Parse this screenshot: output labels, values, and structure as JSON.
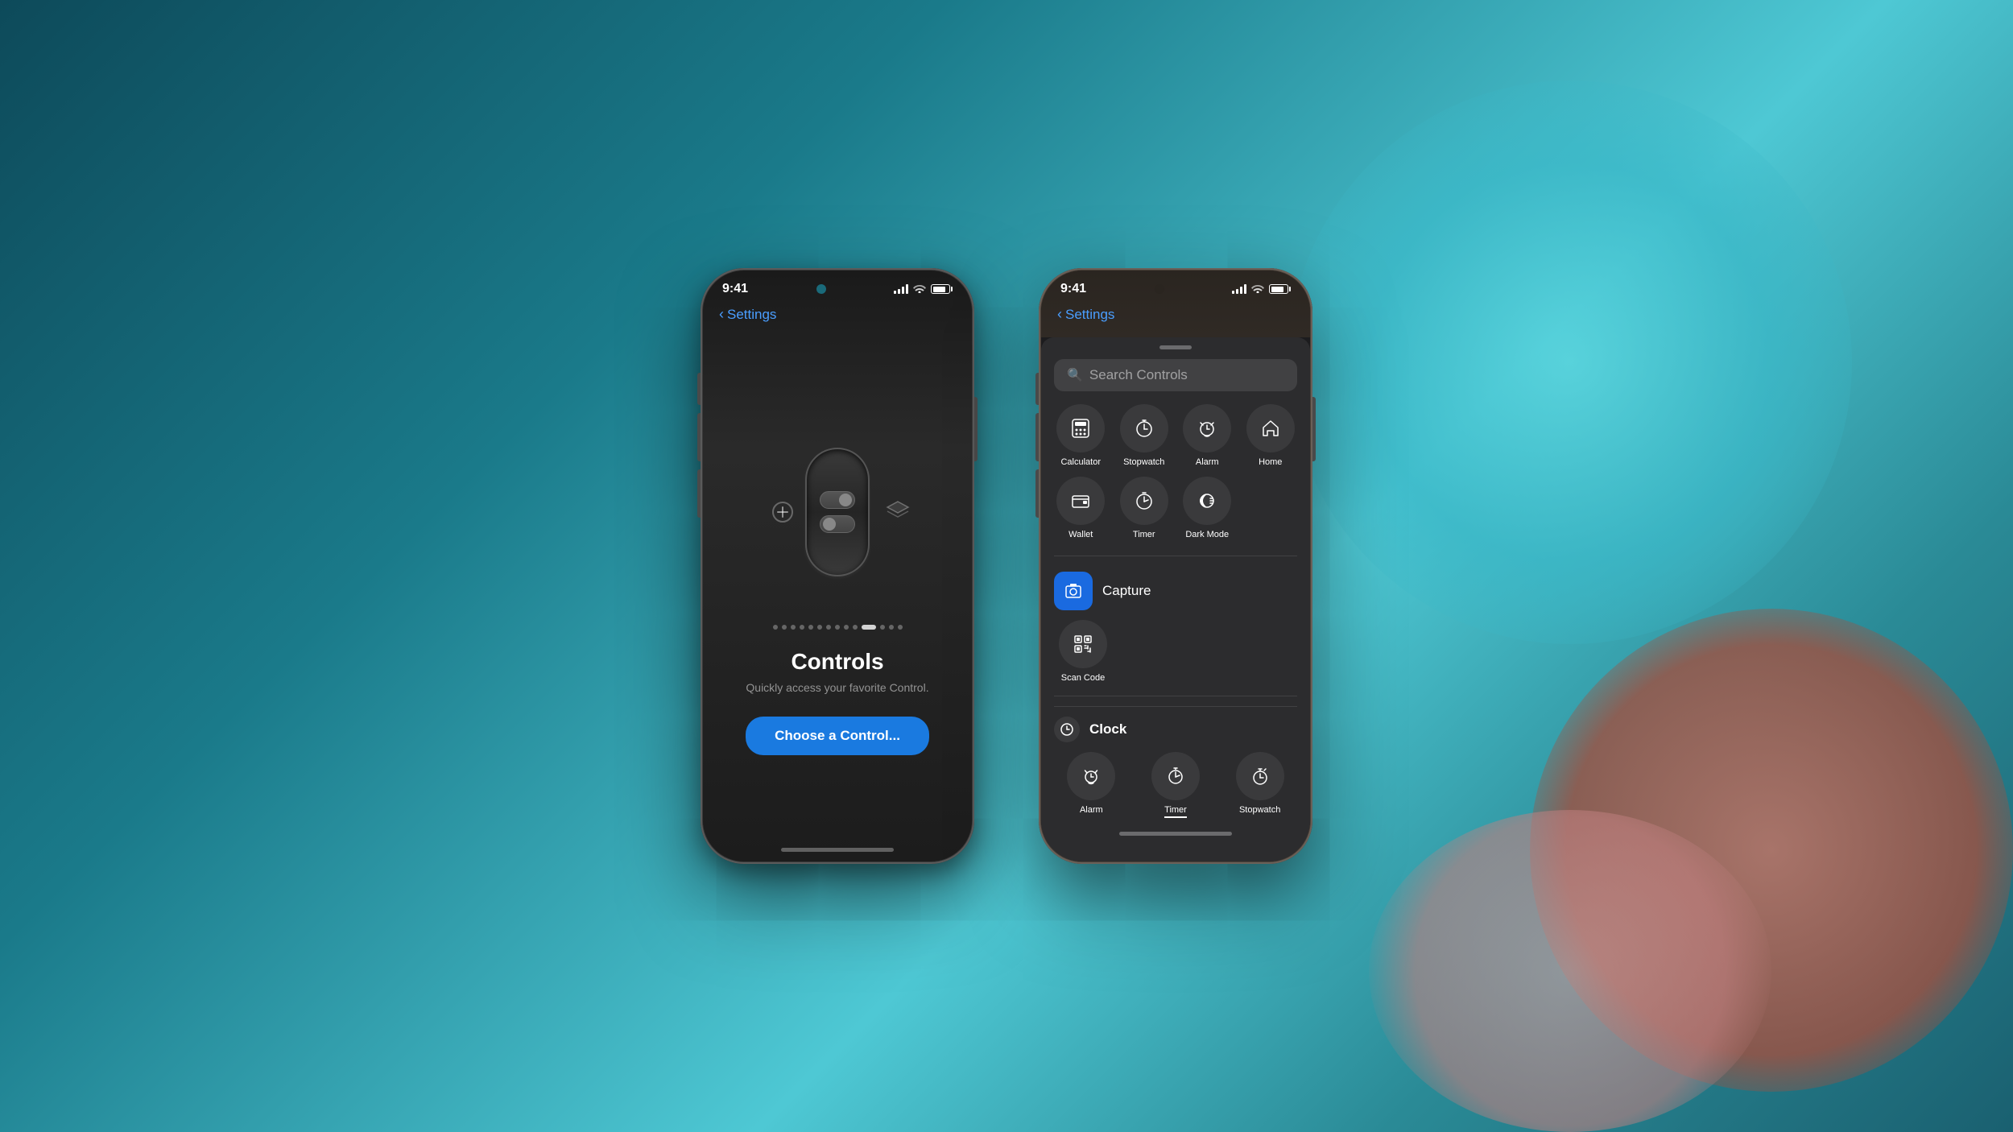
{
  "background": {
    "color": "#1a6b7a"
  },
  "phone1": {
    "status_bar": {
      "time": "9:41",
      "signal": "●●●●",
      "wifi": "wifi",
      "battery": "battery"
    },
    "nav": {
      "back_label": "Settings"
    },
    "pagination": {
      "total": 14,
      "active": 10
    },
    "title": "Controls",
    "subtitle": "Quickly access your favorite Control.",
    "cta_button": "Choose a Control..."
  },
  "phone2": {
    "status_bar": {
      "time": "9:41"
    },
    "nav": {
      "back_label": "Settings"
    },
    "search_placeholder": "Search Controls",
    "grid_items": [
      {
        "icon": "🧮",
        "label": "Calculator"
      },
      {
        "icon": "⏱",
        "label": "Stopwatch"
      },
      {
        "icon": "⏰",
        "label": "Alarm"
      },
      {
        "icon": "🏠",
        "label": "Home"
      },
      {
        "icon": "💳",
        "label": "Wallet"
      },
      {
        "icon": "⏲",
        "label": "Timer"
      },
      {
        "icon": "☀",
        "label": "Dark Mode"
      }
    ],
    "capture_section": {
      "title": "Capture",
      "scan_label": "Scan Code"
    },
    "clock_section": {
      "title": "Clock",
      "items": [
        {
          "icon": "⏰",
          "label": "Alarm"
        },
        {
          "icon": "⏲",
          "label": "Timer",
          "active": true
        },
        {
          "icon": "⏱",
          "label": "Stopwatch"
        }
      ]
    }
  }
}
